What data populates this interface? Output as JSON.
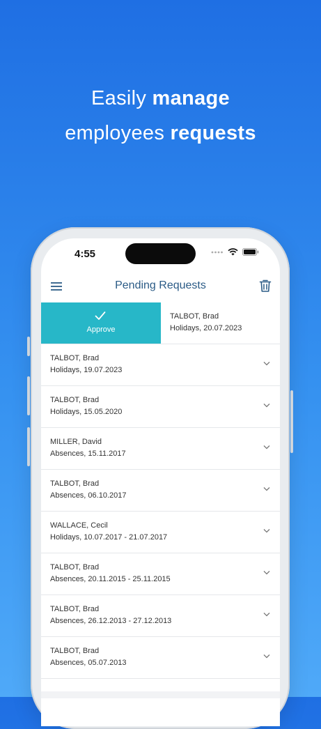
{
  "headline": {
    "line1_regular": "Easily ",
    "line1_bold": "manage",
    "line2_regular": "employees ",
    "line2_bold": "requests"
  },
  "status_bar": {
    "time": "4:55"
  },
  "app_bar": {
    "title": "Pending Requests",
    "menu_icon": "hamburger-menu-icon",
    "delete_icon": "trash-icon"
  },
  "swiped_item": {
    "action_label": "Approve",
    "name": "TALBOT, Brad",
    "detail": "Holidays, 20.07.2023"
  },
  "requests": [
    {
      "name": "TALBOT, Brad",
      "detail": "Holidays, 19.07.2023"
    },
    {
      "name": "TALBOT, Brad",
      "detail": "Holidays, 15.05.2020"
    },
    {
      "name": "MILLER, David",
      "detail": "Absences, 15.11.2017"
    },
    {
      "name": "TALBOT, Brad",
      "detail": "Absences, 06.10.2017"
    },
    {
      "name": "WALLACE, Cecil",
      "detail": "Holidays, 10.07.2017 - 21.07.2017"
    },
    {
      "name": "TALBOT, Brad",
      "detail": "Absences, 20.11.2015 - 25.11.2015"
    },
    {
      "name": "TALBOT, Brad",
      "detail": "Absences, 26.12.2013 - 27.12.2013"
    },
    {
      "name": "TALBOT, Brad",
      "detail": "Absences, 05.07.2013"
    }
  ],
  "colors": {
    "background_top": "#1f6fe3",
    "background_bottom": "#4fa9f8",
    "approve": "#27b7c8",
    "accent": "#2b5b86"
  }
}
